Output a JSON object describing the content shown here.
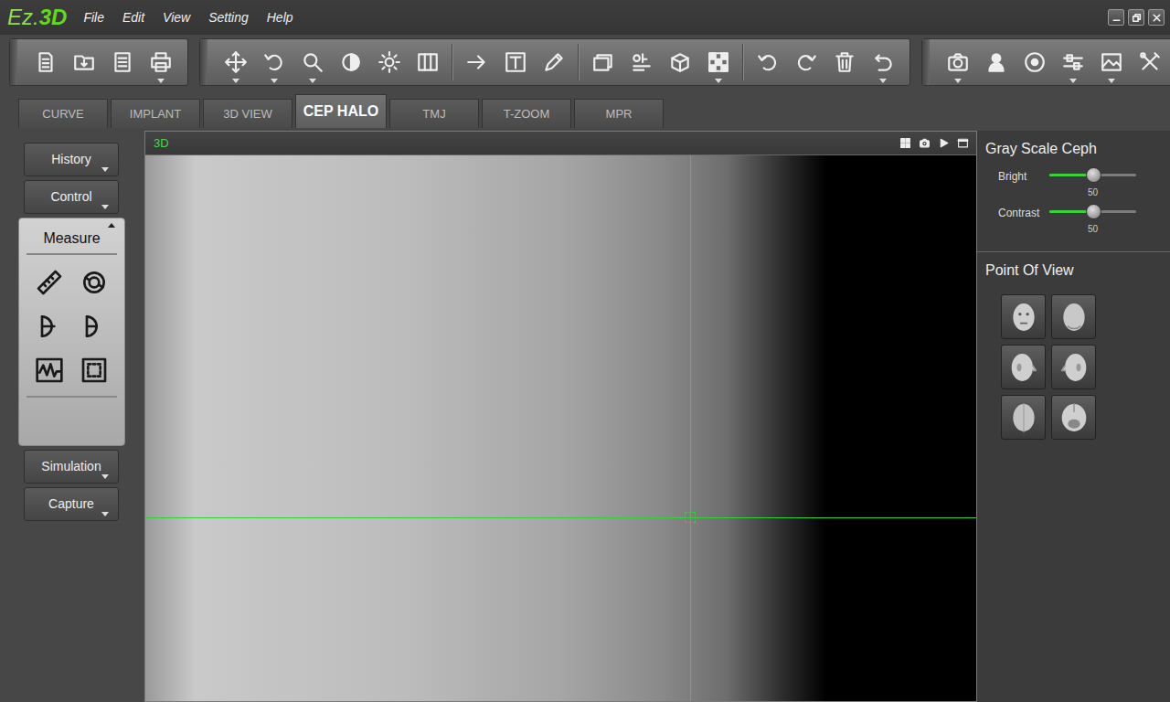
{
  "app": {
    "logo": {
      "prefix": "Ez.",
      "suffix": "3D"
    },
    "menu": [
      "File",
      "Edit",
      "View",
      "Setting",
      "Help"
    ]
  },
  "toolbar": {
    "groups": [
      [
        [
          {
            "dropdown": false
          },
          {
            "dropdown": false
          },
          {
            "dropdown": false
          },
          {
            "dropdown": true
          }
        ]
      ],
      [
        [
          {
            "dropdown": true
          },
          {
            "dropdown": true
          },
          {
            "dropdown": true
          },
          {
            "dropdown": false
          },
          {
            "dropdown": false
          },
          {
            "dropdown": false
          }
        ],
        [
          {
            "dropdown": false
          },
          {
            "dropdown": false
          },
          {
            "dropdown": false
          }
        ],
        [
          {
            "dropdown": false
          },
          {
            "dropdown": false
          },
          {
            "dropdown": false
          },
          {
            "dropdown": true
          }
        ],
        [
          {
            "dropdown": false
          },
          {
            "dropdown": false
          },
          {
            "dropdown": false
          },
          {
            "dropdown": true
          }
        ]
      ],
      [
        [
          {
            "dropdown": true
          },
          {
            "dropdown": false
          },
          {
            "dropdown": false
          },
          {
            "dropdown": true
          },
          {
            "dropdown": true
          },
          {
            "dropdown": false
          }
        ]
      ]
    ]
  },
  "tabs": [
    {
      "label": "CURVE",
      "selected": false
    },
    {
      "label": "IMPLANT",
      "selected": false
    },
    {
      "label": "3D VIEW",
      "selected": false
    },
    {
      "label": "CEP HALO",
      "selected": true
    },
    {
      "label": "TMJ",
      "selected": false
    },
    {
      "label": "T-ZOOM",
      "selected": false
    },
    {
      "label": "MPR",
      "selected": false
    }
  ],
  "sidebar": {
    "items": [
      {
        "label": "History",
        "expanded": false
      },
      {
        "label": "Control",
        "expanded": false
      },
      {
        "label": "Measure",
        "expanded": true
      },
      {
        "label": "Simulation",
        "expanded": false
      },
      {
        "label": "Capture",
        "expanded": false
      }
    ]
  },
  "viewport": {
    "title": "3D"
  },
  "right_panel": {
    "gray_scale": {
      "title": "Gray Scale Ceph",
      "sliders": [
        {
          "label": "Bright",
          "level": 0.5,
          "reading": "50"
        },
        {
          "label": "Contrast",
          "level": 0.5,
          "reading": "50"
        }
      ]
    },
    "point_of_view": {
      "title": "Point Of View"
    }
  }
}
